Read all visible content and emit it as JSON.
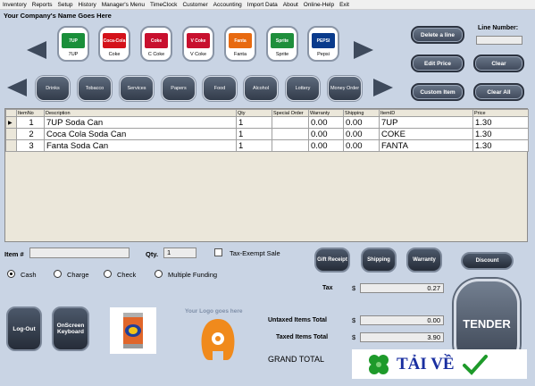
{
  "menu": [
    "Inventory",
    "Reports",
    "Setup",
    "History",
    "Manager's Menu",
    "TimeClock",
    "Customer",
    "Accounting",
    "Import Data",
    "About",
    "Online-Help",
    "Exit"
  ],
  "company_name": "Your Company's Name Goes Here",
  "products": [
    {
      "label": "7UP",
      "logo": "7UP",
      "color": "#1a8f3a"
    },
    {
      "label": "Coke",
      "logo": "Coca-Cola",
      "color": "#d4121a"
    },
    {
      "label": "C Coke",
      "logo": "Coke",
      "color": "#c8102e"
    },
    {
      "label": "V Coke",
      "logo": "V Coke",
      "color": "#c8102e"
    },
    {
      "label": "Fanta",
      "logo": "Fanta",
      "color": "#e86a10"
    },
    {
      "label": "Sprite",
      "logo": "Sprite",
      "color": "#1f8f3c"
    },
    {
      "label": "Pepsi",
      "logo": "PEPSI",
      "color": "#0a3b8c"
    }
  ],
  "categories": [
    "Drinks",
    "Tobacco",
    "Services",
    "Papers",
    "Food",
    "Alcohol",
    "Lottery",
    "Money Order"
  ],
  "top_buttons": {
    "delete_line": "Delete a line",
    "line_number_label": "Line Number:",
    "edit_price": "Edit Price",
    "clear": "Clear",
    "custom_item": "Custom Item",
    "clear_all": "Clear All"
  },
  "grid": {
    "headers": [
      "ItemNo",
      "Description",
      "Qty",
      "Special Order",
      "Warranty",
      "Shipping",
      "ItemID",
      "Price"
    ],
    "rows": [
      [
        "1",
        "7UP Soda Can",
        "1",
        "",
        "0.00",
        "0.00",
        "7UP",
        "1.30"
      ],
      [
        "2",
        "Coca Cola Soda Can",
        "1",
        "",
        "0.00",
        "0.00",
        "COKE",
        "1.30"
      ],
      [
        "3",
        "Fanta Soda Can",
        "1",
        "",
        "0.00",
        "0.00",
        "FANTA",
        "1.30"
      ]
    ]
  },
  "entry": {
    "item_label": "Item #",
    "item_value": "",
    "qty_label": "Qty.",
    "qty_value": "1",
    "tax_exempt_label": "Tax-Exempt Sale"
  },
  "action_buttons": {
    "gift_receipt": "Gift Receipt",
    "shipping": "Shipping",
    "warranty": "Warranty",
    "discount": "Discount"
  },
  "payment": {
    "cash": "Cash",
    "charge": "Charge",
    "check": "Check",
    "multiple": "Multiple Funding",
    "selected": "Cash"
  },
  "totals": {
    "tax_label": "Tax",
    "tax_currency": "$",
    "tax_value": "0.27",
    "untaxed_label": "Untaxed Items Total",
    "untaxed_currency": "$",
    "untaxed_value": "0.00",
    "taxed_label": "Taxed Items Total",
    "taxed_currency": "$",
    "taxed_value": "3.90",
    "grand_label": "GRAND TOTAL"
  },
  "bottom": {
    "logout": "Log-Out",
    "onscreen_keyboard": "OnScreen Keyboard",
    "logo_text": "Your Logo goes here",
    "tender": "TENDER"
  },
  "watermark": "TẢI VỀ"
}
